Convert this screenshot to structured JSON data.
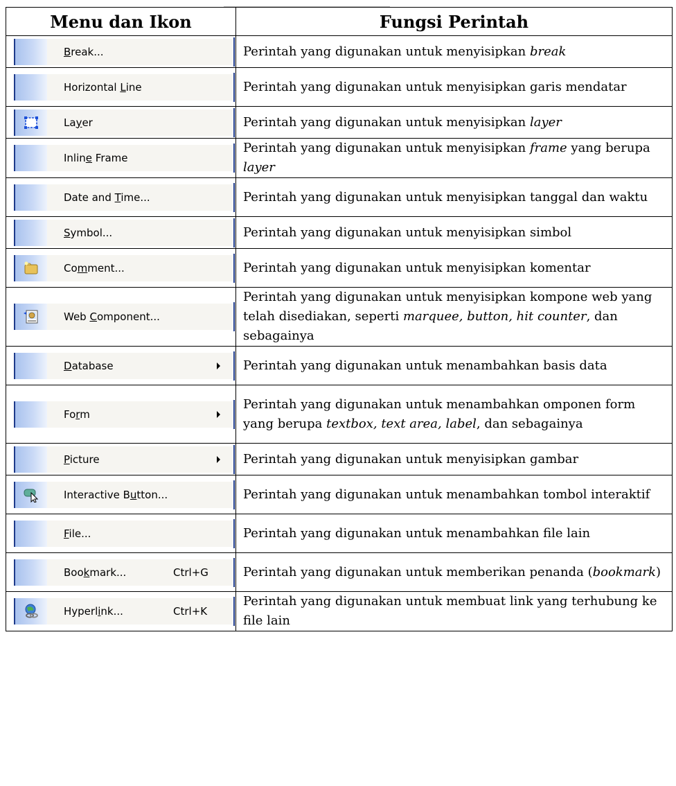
{
  "header": {
    "col1": "Menu dan Ikon",
    "col2": "Fungsi Perintah"
  },
  "rows": [
    {
      "pre": "",
      "ul": "B",
      "post": "reak...",
      "shortcut": "",
      "submenu": false,
      "icon": "none",
      "func": [
        "Perintah yang digunakan untuk menyisipkan ",
        {
          "i": "break"
        }
      ]
    },
    {
      "pre": "Horizontal ",
      "ul": "L",
      "post": "ine",
      "shortcut": "",
      "submenu": false,
      "icon": "none",
      "func": [
        "Perintah yang digunakan untuk menyisipkan garis mendatar"
      ]
    },
    {
      "pre": "La",
      "ul": "y",
      "post": "er",
      "shortcut": "",
      "submenu": false,
      "icon": "layer-icon",
      "func": [
        "Perintah yang digunakan untuk menyisipkan ",
        {
          "i": "layer"
        }
      ]
    },
    {
      "pre": "Inlin",
      "ul": "e",
      "post": " Frame",
      "shortcut": "",
      "submenu": false,
      "icon": "none",
      "func": [
        "Perintah yang digunakan untuk menyisipkan ",
        {
          "i": "frame"
        },
        " yang berupa ",
        {
          "i": "layer"
        }
      ]
    },
    {
      "pre": "Date and ",
      "ul": "T",
      "post": "ime...",
      "shortcut": "",
      "submenu": false,
      "icon": "none",
      "func": [
        "Perintah yang digunakan untuk menyisipkan tanggal dan waktu"
      ]
    },
    {
      "pre": "",
      "ul": "S",
      "post": "ymbol...",
      "shortcut": "",
      "submenu": false,
      "icon": "none",
      "func": [
        "Perintah yang digunakan untuk menyisipkan simbol"
      ]
    },
    {
      "pre": "Co",
      "ul": "m",
      "post": "ment...",
      "shortcut": "",
      "submenu": false,
      "icon": "comment-icon",
      "func": [
        "Perintah yang digunakan untuk menyisipkan komentar"
      ]
    },
    {
      "pre": "Web ",
      "ul": "C",
      "post": "omponent...",
      "shortcut": "",
      "submenu": false,
      "icon": "web-component-icon",
      "func": [
        "Perintah yang digunakan untuk menyisipkan kompone web yang telah disediakan, seperti ",
        {
          "i": "marquee, button, hit counter"
        },
        ", dan sebagainya"
      ]
    },
    {
      "pre": "",
      "ul": "D",
      "post": "atabase",
      "shortcut": "",
      "submenu": true,
      "icon": "none",
      "func": [
        "Perintah yang digunakan untuk menambahkan basis data"
      ]
    },
    {
      "pre": "Fo",
      "ul": "r",
      "post": "m",
      "shortcut": "",
      "submenu": true,
      "icon": "none",
      "func": [
        "Perintah yang digunakan untuk menambahkan omponen form yang berupa ",
        {
          "i": "textbox, text area, label"
        },
        ", dan sebagainya"
      ]
    },
    {
      "pre": "",
      "ul": "P",
      "post": "icture",
      "shortcut": "",
      "submenu": true,
      "icon": "none",
      "func": [
        "Perintah yang digunakan untuk menyisipkan gambar"
      ]
    },
    {
      "pre": "Interactive B",
      "ul": "u",
      "post": "tton...",
      "shortcut": "",
      "submenu": false,
      "icon": "interactive-button-icon",
      "func": [
        "Perintah yang digunakan untuk menambahkan tombol interaktif"
      ]
    },
    {
      "pre": "",
      "ul": "F",
      "post": "ile...",
      "shortcut": "",
      "submenu": false,
      "icon": "none",
      "func": [
        "Perintah yang digunakan untuk menambahkan file lain"
      ]
    },
    {
      "pre": "Boo",
      "ul": "k",
      "post": "mark...",
      "shortcut": "Ctrl+G",
      "submenu": false,
      "icon": "none",
      "func": [
        "Perintah yang digunakan untuk memberikan penanda (",
        {
          "i": "bookmark"
        },
        ")"
      ]
    },
    {
      "pre": "Hyperl",
      "ul": "i",
      "post": "nk...",
      "shortcut": "Ctrl+K",
      "submenu": false,
      "icon": "hyperlink-icon",
      "func": [
        "Perintah yang digunakan untuk membuat link yang terhubung ke file lain"
      ]
    }
  ]
}
